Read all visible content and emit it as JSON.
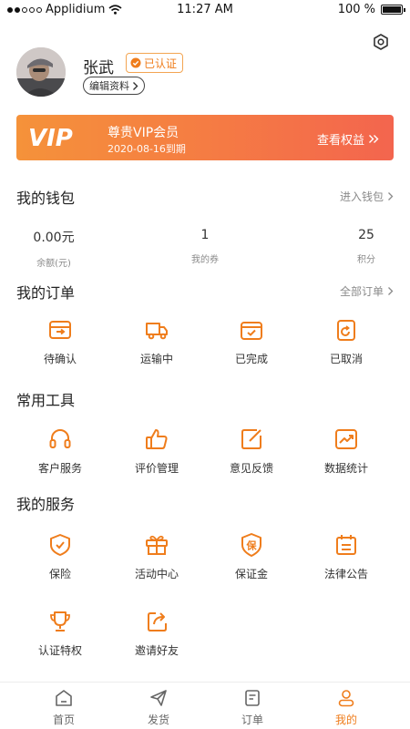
{
  "status_bar": {
    "carrier": "Applidium",
    "time": "11:27 AM",
    "battery": "100 %",
    "battery_level": 1.0
  },
  "profile": {
    "name": "张武",
    "verified_label": "已认证",
    "edit_label": "编辑资料"
  },
  "vip": {
    "logo": "VIP",
    "title": "尊贵VIP会员",
    "expiry": "2020-08-16到期",
    "link_label": "查看权益"
  },
  "wallet": {
    "title": "我的钱包",
    "more_label": "进入钱包",
    "items": [
      {
        "value": "0.00元",
        "label": "余额(元)"
      },
      {
        "value": "1",
        "label": "我的券"
      },
      {
        "value": "25",
        "label": "积分"
      }
    ]
  },
  "orders": {
    "title": "我的订单",
    "more_label": "全部订单",
    "items": [
      {
        "label": "待确认",
        "icon": "pending-confirm-icon"
      },
      {
        "label": "运输中",
        "icon": "truck-icon"
      },
      {
        "label": "已完成",
        "icon": "completed-icon"
      },
      {
        "label": "已取消",
        "icon": "cancelled-icon"
      }
    ]
  },
  "tools": {
    "title": "常用工具",
    "items": [
      {
        "label": "客户服务",
        "icon": "headset-icon"
      },
      {
        "label": "评价管理",
        "icon": "thumbs-up-icon"
      },
      {
        "label": "意见反馈",
        "icon": "feedback-edit-icon"
      },
      {
        "label": "数据统计",
        "icon": "chart-trend-icon"
      }
    ]
  },
  "services": {
    "title": "我的服务",
    "items": [
      {
        "label": "保险",
        "icon": "shield-check-icon"
      },
      {
        "label": "活动中心",
        "icon": "gift-icon"
      },
      {
        "label": "保证金",
        "icon": "deposit-badge-icon",
        "glyph": "保"
      },
      {
        "label": "法律公告",
        "icon": "calendar-notice-icon"
      },
      {
        "label": "认证特权",
        "icon": "trophy-icon"
      },
      {
        "label": "邀请好友",
        "icon": "share-icon"
      }
    ]
  },
  "tabbar": {
    "active_color": "#ef7d1c",
    "items": [
      {
        "label": "首页",
        "icon": "home-icon"
      },
      {
        "label": "发货",
        "icon": "send-icon"
      },
      {
        "label": "订单",
        "icon": "order-doc-icon"
      },
      {
        "label": "我的",
        "icon": "user-icon",
        "active": true
      }
    ]
  },
  "colors": {
    "accent": "#ef7d1c",
    "vip_gradient_start": "#f5923a",
    "vip_gradient_end": "#f3654e"
  }
}
